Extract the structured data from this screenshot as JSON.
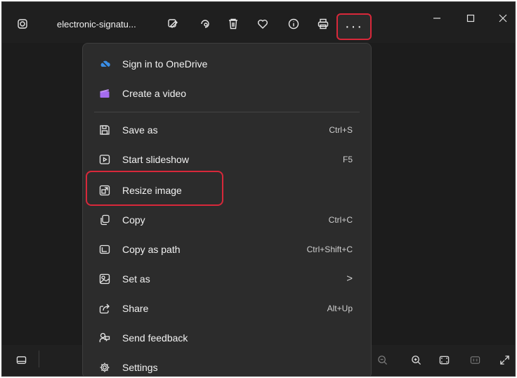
{
  "titlebar": {
    "filename": "electronic-signatu...",
    "more_label": "···"
  },
  "menu": {
    "items": [
      {
        "label": "Sign in to OneDrive",
        "shortcut": "",
        "icon": "onedrive-cloud-icon"
      },
      {
        "label": "Create a video",
        "shortcut": "",
        "icon": "clapperboard-icon"
      },
      {
        "label": "Save as",
        "shortcut": "Ctrl+S",
        "icon": "save-icon"
      },
      {
        "label": "Start slideshow",
        "shortcut": "F5",
        "icon": "slideshow-icon"
      },
      {
        "label": "Resize image",
        "shortcut": "",
        "icon": "resize-icon"
      },
      {
        "label": "Copy",
        "shortcut": "Ctrl+C",
        "icon": "copy-icon"
      },
      {
        "label": "Copy as path",
        "shortcut": "Ctrl+Shift+C",
        "icon": "copy-path-icon"
      },
      {
        "label": "Set as",
        "shortcut": ">",
        "icon": "set-as-icon"
      },
      {
        "label": "Share",
        "shortcut": "Alt+Up",
        "icon": "share-icon"
      },
      {
        "label": "Send feedback",
        "shortcut": "",
        "icon": "feedback-icon"
      },
      {
        "label": "Settings",
        "shortcut": "",
        "icon": "gear-icon"
      }
    ]
  },
  "colors": {
    "highlight": "#d8283a",
    "onedrive": "#3a8ee6",
    "video": "#a56cf0"
  }
}
